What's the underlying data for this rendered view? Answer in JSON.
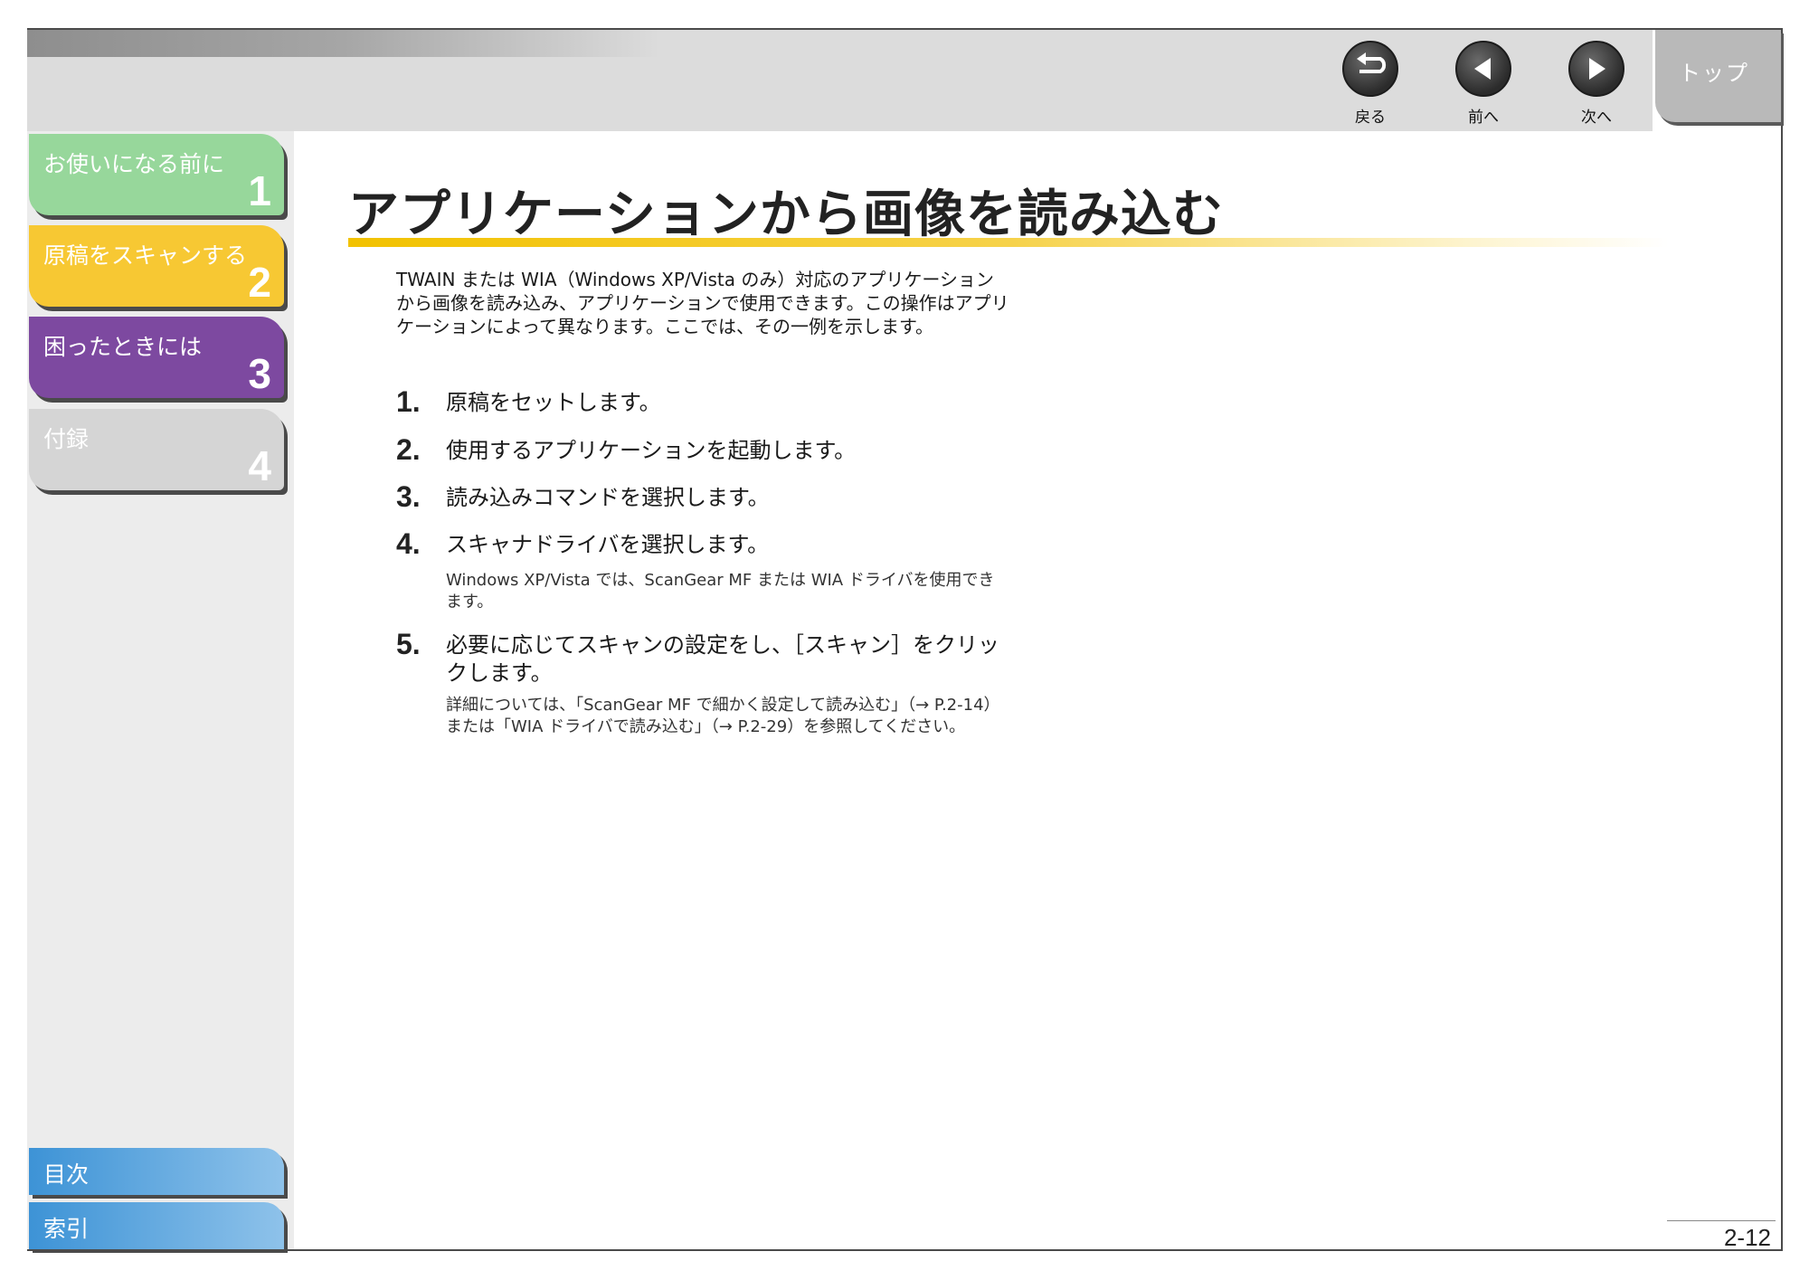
{
  "header": {
    "top_label": "トップ",
    "nav": [
      {
        "label": "戻る",
        "icon": "back-arrow-icon"
      },
      {
        "label": "前へ",
        "icon": "previous-triangle-icon"
      },
      {
        "label": "次へ",
        "icon": "next-triangle-icon"
      }
    ]
  },
  "sidebar": {
    "tabs": [
      {
        "label": "お使いになる前に",
        "number": "1",
        "color": "#97d79b"
      },
      {
        "label": "原稿をスキャンする",
        "number": "2",
        "color": "#f7c833"
      },
      {
        "label": "困ったときには",
        "number": "3",
        "color": "#7d49a0"
      },
      {
        "label": "付録",
        "number": "4",
        "color": "#d5d5d5"
      }
    ],
    "bottom": [
      {
        "label": "目次"
      },
      {
        "label": "索引"
      }
    ]
  },
  "main": {
    "title": "アプリケーションから画像を読み込む",
    "intro": "TWAIN または WIA（Windows XP/Vista のみ）対応のアプリケーションから画像を読み込み、アプリケーションで使用できます。この操作はアプリケーションによって異なります。ここでは、その一例を示します。",
    "steps": [
      {
        "num": "1.",
        "text": "原稿をセットします。",
        "note": ""
      },
      {
        "num": "2.",
        "text": "使用するアプリケーションを起動します。",
        "note": ""
      },
      {
        "num": "3.",
        "text": "読み込みコマンドを選択します。",
        "note": ""
      },
      {
        "num": "4.",
        "text": "スキャナドライバを選択します。",
        "note": "Windows XP/Vista では、ScanGear MF または WIA ドライバを使用できます。"
      },
      {
        "num": "5.",
        "text": "必要に応じてスキャンの設定をし、［スキャン］をクリックします。",
        "note": "詳細については、「ScanGear MF で細かく設定して読み込む」（→ P.2-14）または「WIA ドライバで読み込む」（→ P.2-29）を参照してください。"
      }
    ]
  },
  "footer": {
    "page_number": "2-12"
  }
}
